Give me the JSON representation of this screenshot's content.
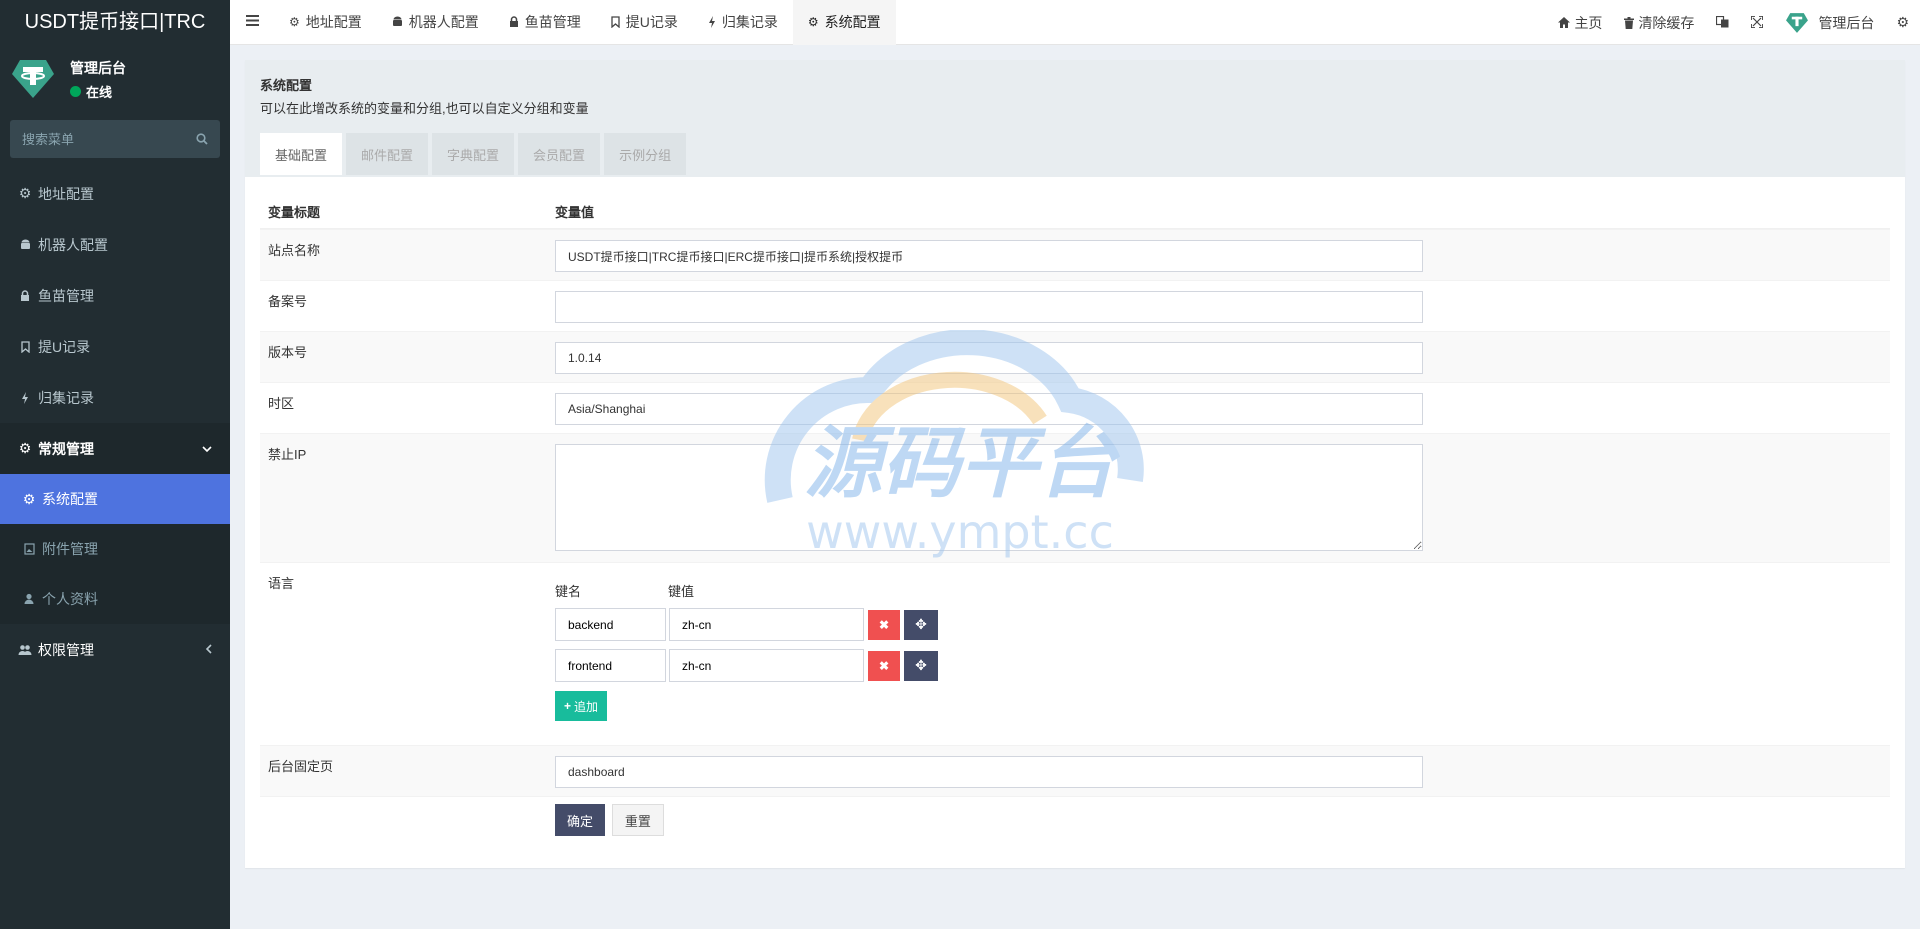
{
  "brand": "USDT提币接口|TRC",
  "user": {
    "name": "管理后台",
    "status": "在线"
  },
  "search": {
    "placeholder": "搜索菜单"
  },
  "sidebar": {
    "items": [
      {
        "label": "地址配置",
        "icon": "gear-icon"
      },
      {
        "label": "机器人配置",
        "icon": "android-icon"
      },
      {
        "label": "鱼苗管理",
        "icon": "lock-icon"
      },
      {
        "label": "提U记录",
        "icon": "bookmark-icon"
      },
      {
        "label": "归集记录",
        "icon": "bolt-icon"
      }
    ],
    "group": {
      "label": "常规管理",
      "icon": "gears-icon"
    },
    "subitems": [
      {
        "label": "系统配置",
        "icon": "gear-icon"
      },
      {
        "label": "附件管理",
        "icon": "image-icon"
      },
      {
        "label": "个人资料",
        "icon": "user-icon"
      }
    ],
    "group2": {
      "label": "权限管理",
      "icon": "users-icon"
    }
  },
  "topnav": {
    "tabs": [
      "地址配置",
      "机器人配置",
      "鱼苗管理",
      "提U记录",
      "归集记录",
      "系统配置"
    ],
    "home": "主页",
    "clear_cache": "清除缓存",
    "admin": "管理后台"
  },
  "panel": {
    "title": "系统配置",
    "desc": "可以在此增改系统的变量和分组,也可以自定义分组和变量",
    "tabs": [
      "基础配置",
      "邮件配置",
      "字典配置",
      "会员配置",
      "示例分组"
    ]
  },
  "form": {
    "head_label": "变量标题",
    "head_value": "变量值",
    "site_name": {
      "label": "站点名称",
      "value": "USDT提币接口|TRC提币接口|ERC提币接口|提币系统|授权提币"
    },
    "beian": {
      "label": "备案号",
      "value": ""
    },
    "version": {
      "label": "版本号",
      "value": "1.0.14"
    },
    "timezone": {
      "label": "时区",
      "value": "Asia/Shanghai"
    },
    "forbidden_ip": {
      "label": "禁止IP",
      "value": ""
    },
    "language": {
      "label": "语言",
      "key_head": "键名",
      "val_head": "键值",
      "rows": [
        {
          "key": "backend",
          "value": "zh-cn"
        },
        {
          "key": "frontend",
          "value": "zh-cn"
        }
      ],
      "add_label": "追加"
    },
    "fixed_page": {
      "label": "后台固定页",
      "value": "dashboard"
    },
    "ok_label": "确定",
    "reset_label": "重置"
  },
  "watermark": {
    "title": "源码平台",
    "url": "www.ympt.cc"
  }
}
